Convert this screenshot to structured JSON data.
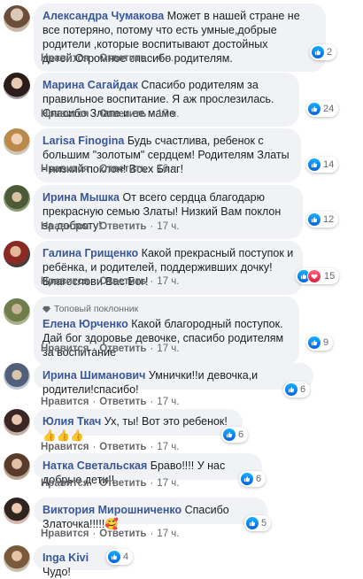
{
  "actions": {
    "like": "Нравится",
    "reply": "Ответить"
  },
  "comments": [
    {
      "author": "Александра Чумакова",
      "text": "Может в нашей стране не все потеряно, потому что есть умные,добрые родители ,которые воспитывают достойных детей.Огромное спасибо родителям.",
      "time": "4 ч.",
      "reactions": "2"
    },
    {
      "author": "Марина Сагайдак",
      "text": "Спасибо родителям за правильное воспитание. Я аж прослезилась. Спасибо Злате и ее маме",
      "time": "17 ч.",
      "reactions": "24"
    },
    {
      "author": "Larisa Finogina",
      "text": "Будь счастлива, ребенок с большим \"золотым\" сердцем! Родителям Златы - низкий поклон! Всех Благ!",
      "time": "16 ч.",
      "reactions": "14"
    },
    {
      "author": "Ирина Мышка",
      "text": "От всего сердца благодарю прекрасную семью Златы! Низкий Вам поклон за доброту!",
      "time": "17 ч.",
      "reactions": "12"
    },
    {
      "author": "Галина Грищенко",
      "text": "Какой прекрасный поступок и ребёнка, и родителей, поддерживших дочку! Благослови Вас Бог!",
      "time": "17 ч.",
      "reactions": "15"
    },
    {
      "badge": "Топовый поклонник",
      "author": "Елена Юрченко",
      "text": "Какой благородный поступок. Дай бог здоровье девочке, спасибо родителям за воспитание",
      "time": "17 ч.",
      "reactions": "9"
    },
    {
      "author": "Ирина Шиманович",
      "text": "Умнички!!и девочка,и родители!спасибо!",
      "time": "17 ч.",
      "reactions": "6"
    },
    {
      "author": "Юлия Ткач",
      "text": "Ух, ты! Вот это ребенок! 👍👍👍",
      "time": "17 ч.",
      "reactions": "6"
    },
    {
      "author": "Натка Светальская",
      "text": "Браво!!!! У нас добрые дети!!",
      "time": "17 ч.",
      "reactions": "6"
    },
    {
      "author": "Виктория Мирошниченко",
      "text": "Спасибо Златочка!!!!!🥰",
      "time": "17 ч.",
      "reactions": "5"
    },
    {
      "author": "Inga Kivi",
      "text": "Чудо!",
      "time": "",
      "reactions": "4"
    }
  ],
  "icons": {
    "like": "like-icon",
    "love": "love-icon",
    "badge": "diamond-icon"
  },
  "colors": {
    "author": "#385898",
    "bubble": "#f0f2f5",
    "like": "#1877f2"
  }
}
